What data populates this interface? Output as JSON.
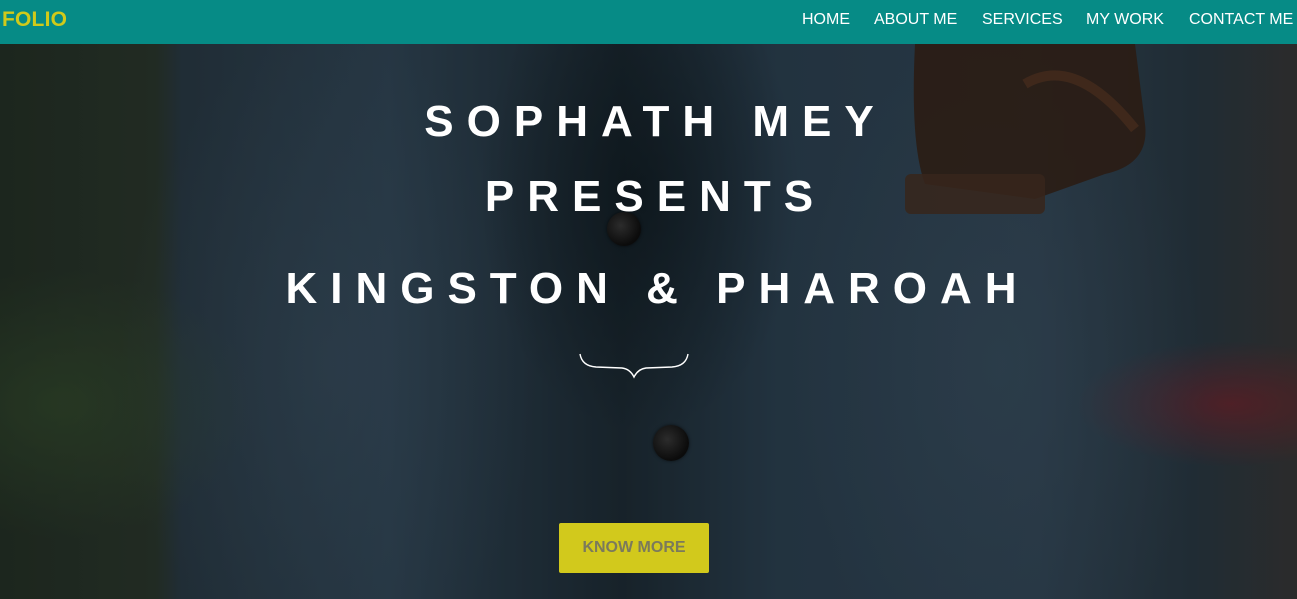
{
  "navbar": {
    "brand": "FOLIO",
    "links": [
      "HOME",
      "ABOUT ME",
      "SERVICES",
      "MY WORK",
      "CONTACT ME"
    ]
  },
  "hero": {
    "headline_line1": "SOPHATH MEY",
    "headline_line2": "PRESENTS",
    "headline_line3": "KINGSTON & PHAROAH",
    "divider_icon": "curly-brace-divider-icon",
    "cta_label": "KNOW MORE"
  },
  "colors": {
    "navbar_bg": "#068b86",
    "brand": "#d0ca1a",
    "cta_bg": "#d2c91c",
    "cta_text": "#7b7a5c",
    "text": "#ffffff"
  }
}
